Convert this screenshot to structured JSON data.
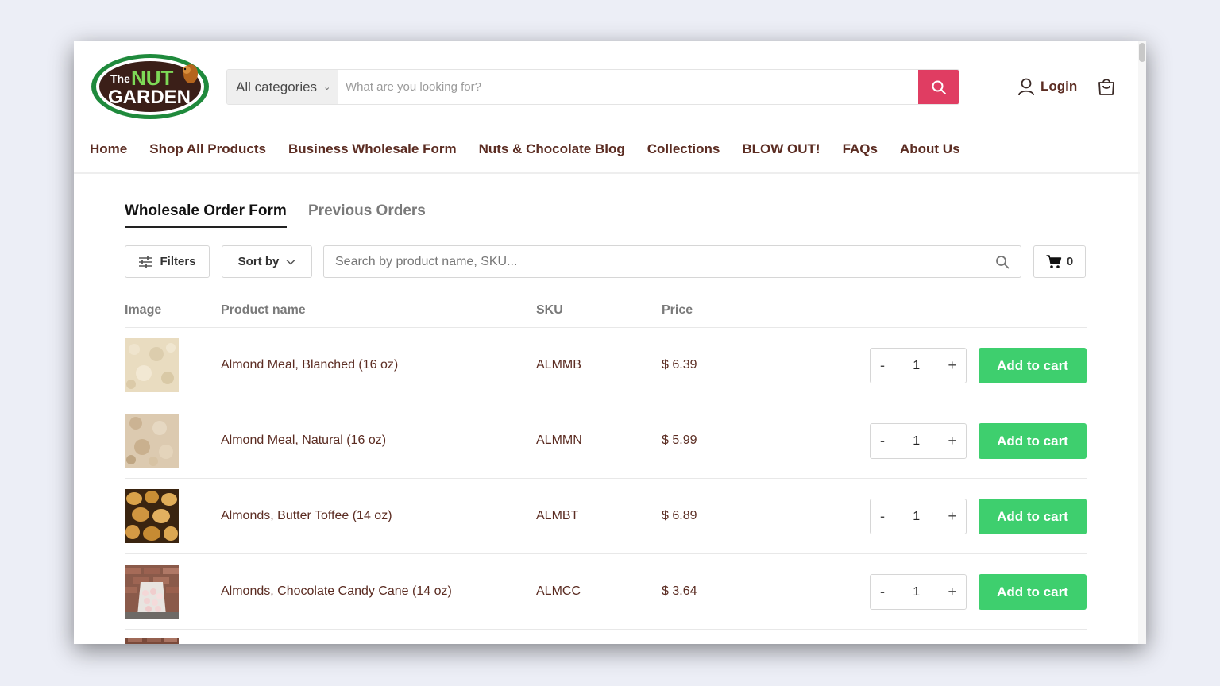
{
  "logo": {
    "text_the": "The",
    "text_nut": "NUT",
    "text_garden": "GARDEN"
  },
  "search": {
    "category_label": "All categories",
    "placeholder": "What are you looking for?"
  },
  "header": {
    "login_label": "Login"
  },
  "nav": {
    "items": [
      "Home",
      "Shop All Products",
      "Business Wholesale Form",
      "Nuts & Chocolate Blog",
      "Collections",
      "BLOW OUT!",
      "FAQs",
      "About Us"
    ]
  },
  "tabs": {
    "active": "Wholesale Order Form",
    "inactive": "Previous Orders"
  },
  "toolbar": {
    "filters_label": "Filters",
    "sort_label": "Sort by",
    "search_placeholder": "Search by product name, SKU...",
    "cart_count": "0"
  },
  "table": {
    "headers": {
      "image": "Image",
      "name": "Product name",
      "sku": "SKU",
      "price": "Price"
    },
    "rows": [
      {
        "name": "Almond Meal, Blanched (16 oz)",
        "sku": "ALMMB",
        "price": "$ 6.39",
        "qty": "1",
        "button": "Add to cart"
      },
      {
        "name": "Almond Meal, Natural (16 oz)",
        "sku": "ALMMN",
        "price": "$ 5.99",
        "qty": "1",
        "button": "Add to cart"
      },
      {
        "name": "Almonds, Butter Toffee (14 oz)",
        "sku": "ALMBT",
        "price": "$ 6.89",
        "qty": "1",
        "button": "Add to cart"
      },
      {
        "name": "Almonds, Chocolate Candy Cane (14 oz)",
        "sku": "ALMCC",
        "price": "$ 3.64",
        "qty": "1",
        "button": "Add to cart"
      }
    ]
  },
  "icons": {
    "search": "search-icon",
    "user": "user-icon",
    "cart": "shopping-bag-icon",
    "filters": "sliders-icon",
    "sort": "chevron-down-icon",
    "table_cart": "shopping-cart-icon"
  },
  "colors": {
    "brand_text": "#5b2c22",
    "search_button": "#e03d62",
    "add_to_cart": "#3ecf6e",
    "logo_green": "#1f8a3c",
    "logo_dark": "#3b1f18"
  }
}
